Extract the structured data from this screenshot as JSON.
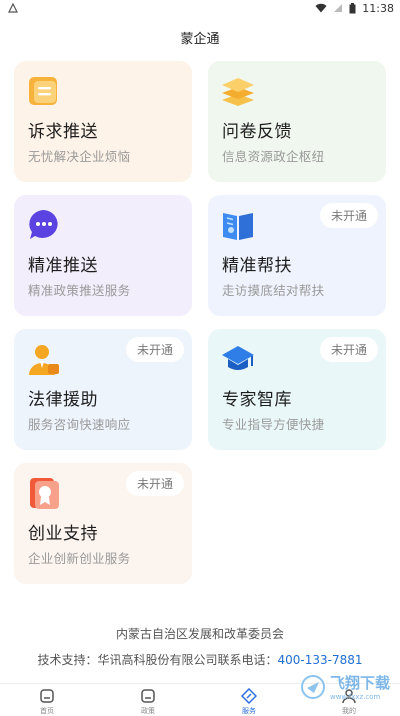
{
  "status_bar": {
    "time": "11:38",
    "left_icon": "android-notification-icon"
  },
  "header": {
    "title": "蒙企通"
  },
  "cards": [
    {
      "title": "诉求推送",
      "subtitle": "无忧解决企业烦恼",
      "badge": "",
      "icon": "document-icon",
      "color": "#f5a623"
    },
    {
      "title": "问卷反馈",
      "subtitle": "信息资源政企枢纽",
      "badge": "",
      "icon": "stack-layers-icon",
      "color": "#f5a623"
    },
    {
      "title": "精准推送",
      "subtitle": "精准政策推送服务",
      "badge": "",
      "icon": "chat-bubble-icon",
      "color": "#6a4df0"
    },
    {
      "title": "精准帮扶",
      "subtitle": "走访摸底结对帮扶",
      "badge": "未开通",
      "icon": "book-icon",
      "color": "#3b8cf0"
    },
    {
      "title": "法律援助",
      "subtitle": "服务咨询快速响应",
      "badge": "未开通",
      "icon": "lawyer-person-icon",
      "color": "#f5a623"
    },
    {
      "title": "专家智库",
      "subtitle": "专业指导方便快捷",
      "badge": "未开通",
      "icon": "graduation-cap-icon",
      "color": "#2f7de6"
    },
    {
      "title": "创业支持",
      "subtitle": "企业创新创业服务",
      "badge": "未开通",
      "icon": "certificate-icon",
      "color": "#f05a3a"
    }
  ],
  "footer": {
    "org": "内蒙古自治区发展和改革委员会",
    "support_prefix": "技术支持：华讯高科股份有限公司联系电话：",
    "phone": "400-133-7881"
  },
  "tabbar": {
    "items": [
      {
        "label": "首页",
        "icon": "home-icon",
        "active": false
      },
      {
        "label": "政策",
        "icon": "policy-icon",
        "active": false
      },
      {
        "label": "服务",
        "icon": "service-compass-icon",
        "active": true
      },
      {
        "label": "我的",
        "icon": "user-icon",
        "active": false
      }
    ]
  },
  "watermark": {
    "text": "飞翔下载",
    "url_text": "www.fxxz.com"
  }
}
